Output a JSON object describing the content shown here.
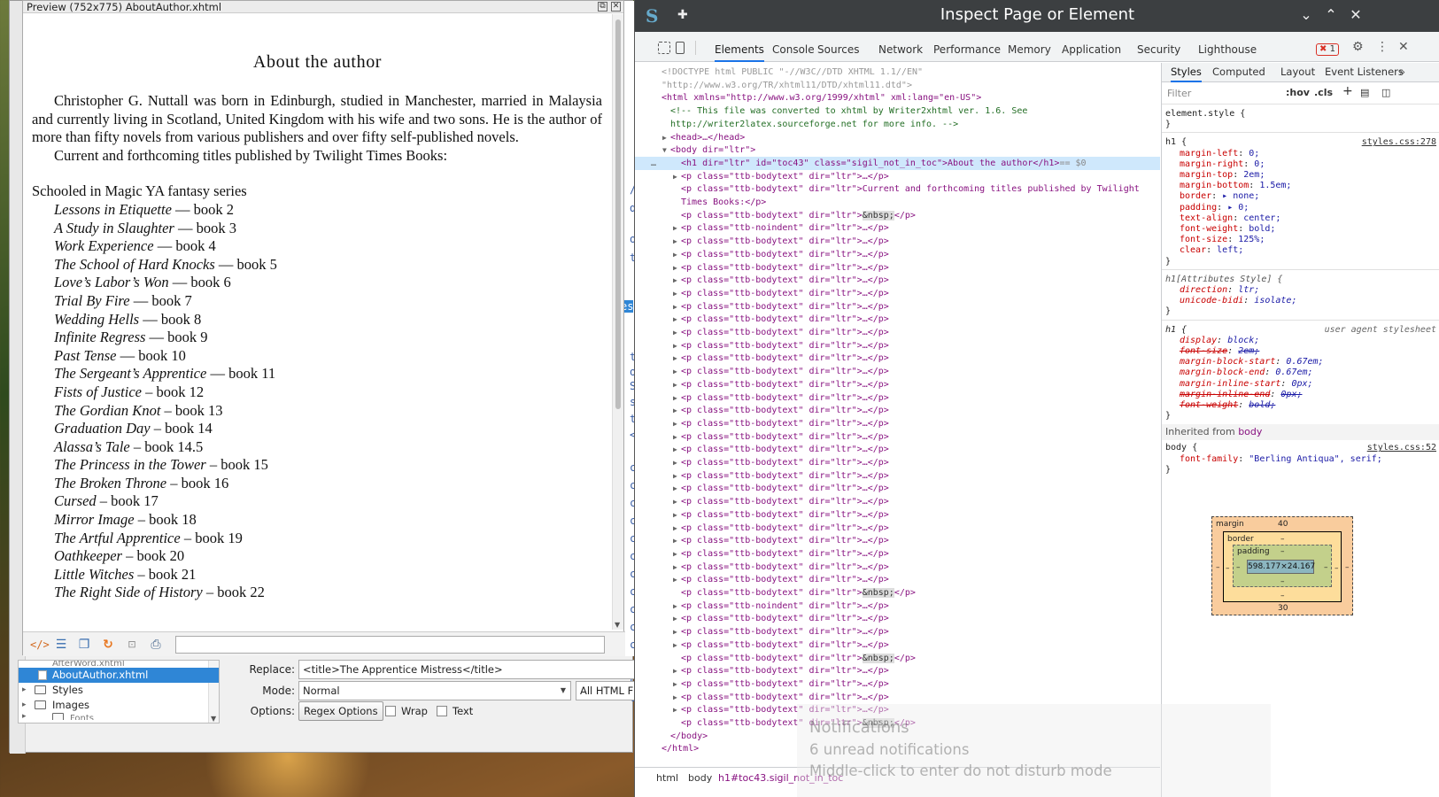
{
  "preview": {
    "window_title": "Preview (752x775) AboutAuthor.xhtml",
    "heading": "About the author",
    "para1": "Christopher G. Nuttall was born in Edinburgh, studied in Manchester, married in Malaysia and currently living in Scotland, United Kingdom with his wife and two sons. He is the author of more than fifty novels from various publishers and over fifty self-published novels.",
    "para2": "Current and forthcoming titles published by Twilight Times Books:",
    "series_heading": "Schooled in Magic YA fantasy series",
    "books": [
      {
        "title": "Lessons in Etiquette",
        "sep": " — ",
        "num": "book 2"
      },
      {
        "title": "A Study in Slaughter",
        "sep": " — ",
        "num": "book 3"
      },
      {
        "title": "Work Experience",
        "sep": " — ",
        "num": "book 4"
      },
      {
        "title": "The School of Hard Knocks",
        "sep": " — ",
        "num": "book 5"
      },
      {
        "title": "Love’s Labor’s Won",
        "sep": " — ",
        "num": "book 6"
      },
      {
        "title": "Trial By Fire",
        "sep": " — ",
        "num": "book 7"
      },
      {
        "title": "Wedding Hells",
        "sep": " — ",
        "num": "book 8"
      },
      {
        "title": "Infinite Regress",
        "sep": " — ",
        "num": "book 9"
      },
      {
        "title": "Past Tense",
        "sep": " — ",
        "num": "book 10"
      },
      {
        "title": "The Sergeant’s Apprentice",
        "sep": " — ",
        "num": "book 11"
      },
      {
        "title": "Fists of Justice",
        "sep": " – ",
        "num": "book 12"
      },
      {
        "title": "The Gordian Knot",
        "sep": " – ",
        "num": "book 13"
      },
      {
        "title": "Graduation Day",
        "sep": " – ",
        "num": "book 14"
      },
      {
        "title": "Alassa’s Tale",
        "sep": " – ",
        "num": "book 14.5"
      },
      {
        "title": "The Princess in the Tower",
        "sep": " – ",
        "num": "book 15"
      },
      {
        "title": "The Broken Throne",
        "sep": " – ",
        "num": "book 16"
      },
      {
        "title": "Cursed",
        "sep": " – ",
        "num": "book 17"
      },
      {
        "title": "Mirror Image",
        "sep": " – ",
        "num": "book 18"
      },
      {
        "title": "The Artful Apprentice",
        "sep": " – ",
        "num": "book 19"
      },
      {
        "title": "Oathkeeper",
        "sep": " – ",
        "num": "book 20"
      },
      {
        "title": "Little Witches",
        "sep": " – ",
        "num": "book 21"
      },
      {
        "title": "The Right Side of History",
        "sep": " – ",
        "num": "book 22"
      }
    ],
    "toolbar_icons": [
      "code-view-icon",
      "toc-icon",
      "copy-icon",
      "reload-icon",
      "zoom-icon",
      "print-icon"
    ]
  },
  "sigil": {
    "tree_items": [
      {
        "label": "AfterWord.xhtml",
        "type": "file",
        "cut": true
      },
      {
        "label": "AboutAuthor.xhtml",
        "type": "file",
        "selected": true
      },
      {
        "label": "Styles",
        "type": "folder"
      },
      {
        "label": "Images",
        "type": "folder"
      },
      {
        "label": "Fonts",
        "type": "folder",
        "cut": true
      }
    ],
    "replace_label": "Replace:",
    "replace_value": "<title>The Apprentice Mistress</title>",
    "mode_label": "Mode:",
    "mode_value": "Normal",
    "scope_value": "All HTML F",
    "options_label": "Options:",
    "regex_button": "Regex Options",
    "wrap_label": "Wrap",
    "text_label": "Text",
    "code_fragments": [
      "//",
      "dt",
      "or",
      "te",
      "es",
      "t_",
      "op",
      "Sc",
      "s",
      "t",
      "</",
      "cl",
      "cl",
      "cl",
      "cl",
      "cl",
      "cl",
      "cl",
      "cl",
      "cl",
      "cl",
      "cl",
      "cl",
      "cl",
      "cl"
    ],
    "selection_color": "#2f86d6"
  },
  "devtools": {
    "window_title": "Inspect Page or Element",
    "tabs": [
      "Elements",
      "Console",
      "Sources",
      "Network",
      "Performance",
      "Memory",
      "Application",
      "Security",
      "Lighthouse"
    ],
    "active_tab": "Elements",
    "error_count": "1",
    "dom": {
      "doctype1": "<!DOCTYPE html PUBLIC \"-//W3C//DTD XHTML 1.1//EN\"",
      "doctype2": "\"http://www.w3.org/TR/xhtml11/DTD/xhtml11.dtd\">",
      "html_open": "<html xmlns=\"http://www.w3.org/1999/xhtml\" xml:lang=\"en-US\">",
      "comment1": "<!-- This file was converted to xhtml by Writer2xhtml ver. 1.6. See",
      "comment2": "http://writer2latex.sourceforge.net for more info. -->",
      "head": "<head>…</head>",
      "body_open": "<body dir=\"ltr\">",
      "h1_line": "<h1 dir=\"ltr\" id=\"toc43\" class=\"sigil_not_in_toc\">About the author</h1>",
      "h1_eq": "== $0",
      "p_current_1": "<p class=\"ttb-bodytext\" dir=\"ltr\">Current and forthcoming titles published by Twilight",
      "p_current_2": "Times Books:</p>",
      "collapsed_body": "<p class=\"ttb-bodytext\" dir=\"ltr\">…</p>",
      "collapsed_noindent": "<p class=\"ttb-noindent\" dir=\"ltr\">…</p>",
      "nbsp_open": "<p class=\"ttb-bodytext\" dir=\"ltr\">",
      "nbsp_entity": "&nbsp;",
      "nbsp_close": "</p>",
      "body_close": "</body>",
      "html_close": "</html>"
    },
    "breadcrumbs": [
      "html",
      "body",
      "h1#toc43.sigil_not_in_toc"
    ],
    "styles": {
      "tabs": [
        "Styles",
        "Computed",
        "Layout",
        "Event Listeners"
      ],
      "filter_placeholder": "Filter",
      "hov": ":hov",
      "cls": ".cls",
      "element_style": "element.style {",
      "close_brace": "}",
      "h1_selector": "h1 {",
      "h1_source": "styles.css:278",
      "h1_props": [
        {
          "name": "margin-left",
          "value": "0;"
        },
        {
          "name": "margin-right",
          "value": "0;"
        },
        {
          "name": "margin-top",
          "value": "2em;"
        },
        {
          "name": "margin-bottom",
          "value": "1.5em;"
        },
        {
          "name": "border",
          "value": "▸ none;"
        },
        {
          "name": "padding",
          "value": "▸ 0;"
        },
        {
          "name": "text-align",
          "value": "center;"
        },
        {
          "name": "font-weight",
          "value": "bold;"
        },
        {
          "name": "font-size",
          "value": "125%;"
        },
        {
          "name": "clear",
          "value": "left;"
        }
      ],
      "attr_selector": "h1[Attributes Style] {",
      "attr_props": [
        {
          "name": "direction",
          "value": "ltr;"
        },
        {
          "name": "unicode-bidi",
          "value": "isolate;"
        }
      ],
      "ua_selector": "h1 {",
      "ua_source": "user agent stylesheet",
      "ua_props": [
        {
          "name": "display",
          "value": "block;",
          "strike": false
        },
        {
          "name": "font-size",
          "value": "2em;",
          "strike": true
        },
        {
          "name": "margin-block-start",
          "value": "0.67em;",
          "strike": false
        },
        {
          "name": "margin-block-end",
          "value": "0.67em;",
          "strike": false
        },
        {
          "name": "margin-inline-start",
          "value": "0px;",
          "strike": false
        },
        {
          "name": "margin-inline-end",
          "value": "0px;",
          "strike": true
        },
        {
          "name": "font-weight",
          "value": "bold;",
          "strike": true
        }
      ],
      "inherited_label": "Inherited from",
      "inherited_from": "body",
      "body_selector": "body {",
      "body_source": "styles.css:52",
      "body_props": [
        {
          "name": "font-family",
          "value": "\"Berling Antiqua\", serif;"
        }
      ],
      "box_model": {
        "margin_label": "margin",
        "margin_top": "40",
        "margin_bottom": "30",
        "margin_side": "–",
        "border_label": "border",
        "border_value": "–",
        "padding_label": "padding",
        "padding_value": "–",
        "content": "598.177×24.167"
      }
    },
    "colors": {
      "accent": "#1a73e8",
      "titlebar": "#3c3f41",
      "error": "#d93025"
    }
  },
  "notification": {
    "title": "Notifications",
    "subtitle": "6 unread notifications",
    "hint": "Middle-click to enter do not disturb mode"
  }
}
